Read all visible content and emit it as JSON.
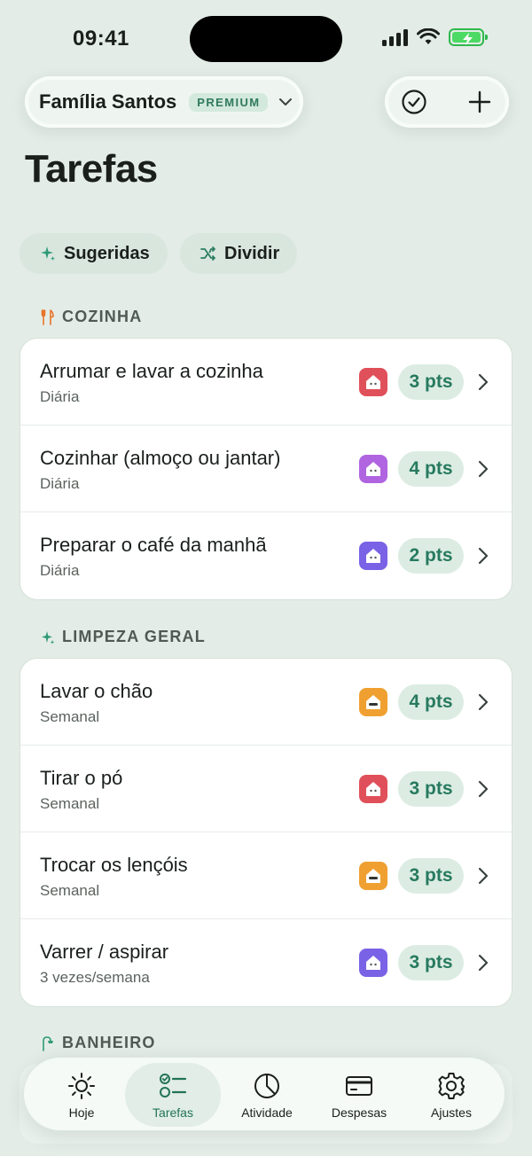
{
  "status_bar": {
    "time": "09:41"
  },
  "header": {
    "family_name": "Família Santos",
    "premium_label": "PREMIUM",
    "page_title": "Tarefas"
  },
  "chips": [
    {
      "label": "Sugeridas",
      "icon": "sparkle-icon"
    },
    {
      "label": "Dividir",
      "icon": "shuffle-icon"
    }
  ],
  "sections": [
    {
      "title": "COZINHA",
      "icon": "fork-knife-icon",
      "tasks": [
        {
          "title": "Arrumar e lavar a cozinha",
          "frequency": "Diária",
          "points": "3 pts",
          "avatar_color": "#e0505a"
        },
        {
          "title": "Cozinhar (almoço ou jantar)",
          "frequency": "Diária",
          "points": "4 pts",
          "avatar_color": "#b064e0"
        },
        {
          "title": "Preparar o café da manhã",
          "frequency": "Diária",
          "points": "2 pts",
          "avatar_color": "#7a62e6"
        }
      ]
    },
    {
      "title": "LIMPEZA GERAL",
      "icon": "sparkle-icon",
      "tasks": [
        {
          "title": "Lavar o chão",
          "frequency": "Semanal",
          "points": "4 pts",
          "avatar_color": "#f0a030"
        },
        {
          "title": "Tirar o pó",
          "frequency": "Semanal",
          "points": "3 pts",
          "avatar_color": "#e0505a"
        },
        {
          "title": "Trocar os lençóis",
          "frequency": "Semanal",
          "points": "3 pts",
          "avatar_color": "#f0a030"
        },
        {
          "title": "Varrer / aspirar",
          "frequency": "3 vezes/semana",
          "points": "3 pts",
          "avatar_color": "#7a62e6"
        }
      ]
    },
    {
      "title": "BANHEIRO",
      "icon": "shower-icon",
      "tasks": []
    }
  ],
  "tab_bar": {
    "items": [
      {
        "label": "Hoje",
        "icon": "sun-icon",
        "active": false
      },
      {
        "label": "Tarefas",
        "icon": "checklist-icon",
        "active": true
      },
      {
        "label": "Atividade",
        "icon": "pie-chart-icon",
        "active": false
      },
      {
        "label": "Despesas",
        "icon": "credit-card-icon",
        "active": false
      },
      {
        "label": "Ajustes",
        "icon": "gear-icon",
        "active": false
      }
    ]
  },
  "colors": {
    "background": "#e3ece6",
    "accent": "#277a5f",
    "points_bg": "#dcece3",
    "section_icon_cozinha": "#e8742a",
    "section_icon_limpeza": "#2f9a78"
  }
}
